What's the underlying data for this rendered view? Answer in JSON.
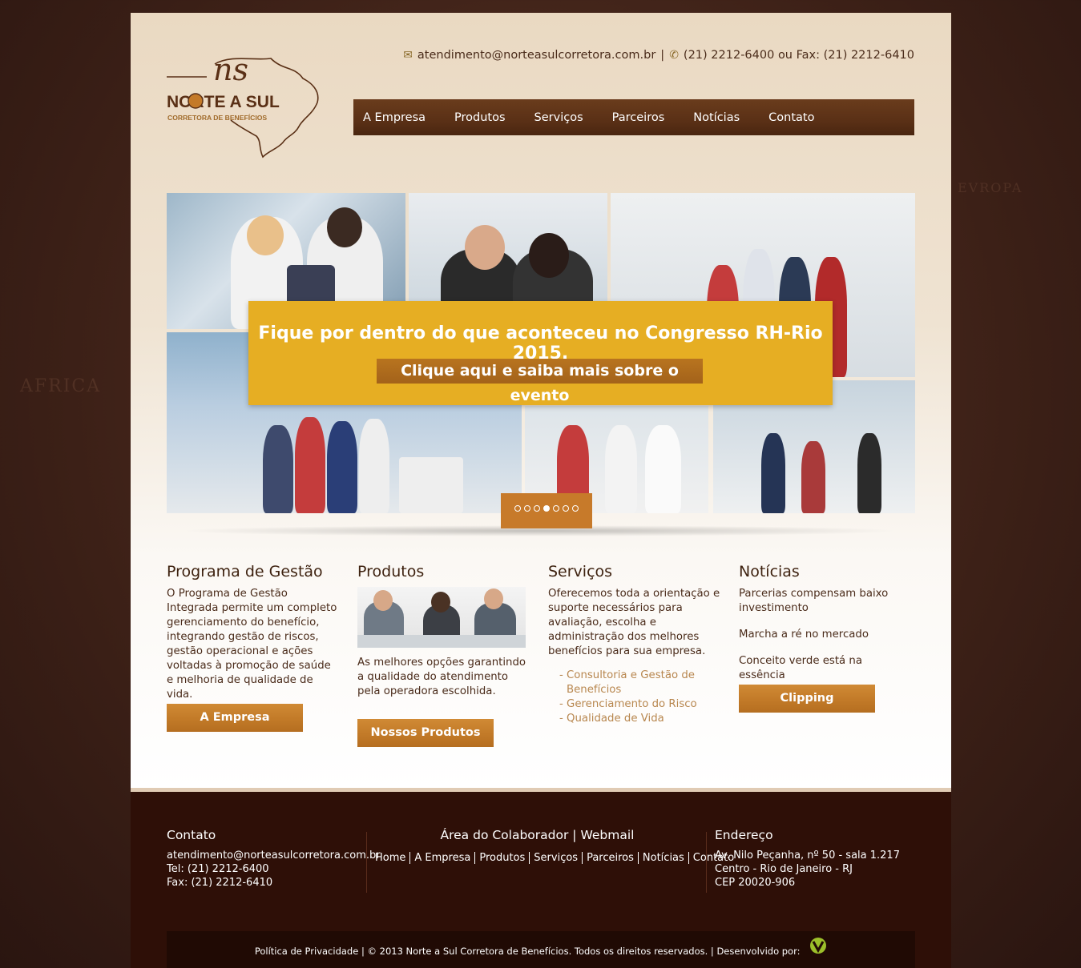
{
  "header": {
    "logo_brand": "NORTE A SUL",
    "logo_tagline": "CORRETORA DE BENEFÍCIOS",
    "logo_monogram": "ns",
    "email": "atendimento@norteasulcorretora.com.br",
    "separator": "|",
    "phone": "(21) 2212-6400 ou Fax: (21) 2212-6410",
    "icons": {
      "email": "envelope-icon",
      "phone": "phone-icon"
    }
  },
  "nav": {
    "items": [
      {
        "label": "A Empresa"
      },
      {
        "label": "Produtos"
      },
      {
        "label": "Serviços"
      },
      {
        "label": "Parceiros"
      },
      {
        "label": "Notícias"
      },
      {
        "label": "Contato"
      }
    ]
  },
  "slider": {
    "headline": "Fique por dentro do que aconteceu no Congresso RH-Rio 2015.",
    "cta": "Clique aqui e saiba mais sobre o evento",
    "dot_count": 7,
    "active_dot": 3
  },
  "columns": {
    "gestao": {
      "title": "Programa de Gestão",
      "text": "O Programa de Gestão Integrada permite um completo gerenciamento do benefício, integrando gestão de riscos, gestão operacional e ações voltadas à promoção de saúde e melhoria de qualidade de vida.",
      "button": "A Empresa"
    },
    "produtos": {
      "title": "Produtos",
      "text": "As melhores opções garantindo a qualidade do atendimento pela operadora escolhida.",
      "button": "Nossos Produtos"
    },
    "servicos": {
      "title": "Serviços",
      "text": "Oferecemos toda a orientação e suporte necessários para avaliação, escolha e administração dos melhores benefícios para sua empresa.",
      "links": [
        "- Consultoria e Gestão de Benefícios",
        "- Gerenciamento do Risco",
        "- Qualidade de Vida"
      ]
    },
    "noticias": {
      "title": "Notícias",
      "items": [
        "Parcerias compensam baixo investimento",
        "Marcha a ré no mercado",
        "Conceito verde está na essência"
      ],
      "button": "Clipping"
    }
  },
  "footer": {
    "contato_title": "Contato",
    "contato_email": "atendimento@norteasulcorretora.com.br",
    "contato_tel": "Tel: (21) 2212-6400",
    "contato_fax": "Fax: (21) 2212-6410",
    "colaborador": "Área do Colaborador",
    "webmail": "Webmail",
    "links": [
      "Home",
      "A Empresa",
      "Produtos",
      "Serviços",
      "Parceiros",
      "Notícias",
      "Contato"
    ],
    "endereco_title": "Endereço",
    "endereco_line1": "Av. Nilo Peçanha, nº 50 - sala 1.217",
    "endereco_line2": "Centro - Rio de Janeiro - RJ",
    "endereco_line3": "CEP 20020-906",
    "copyright": "Política de Privacidade | © 2013 Norte a Sul Corretora de Benefícios. Todos os direitos reservados. | Desenvolvido por:"
  },
  "background_labels": [
    "AFRICA",
    "EVROPA"
  ],
  "colors": {
    "brand_brown": "#5a3016",
    "accent_orange": "#c77a2a",
    "banner_yellow": "#e6ae23",
    "footer_bg": "#2e0f07"
  }
}
